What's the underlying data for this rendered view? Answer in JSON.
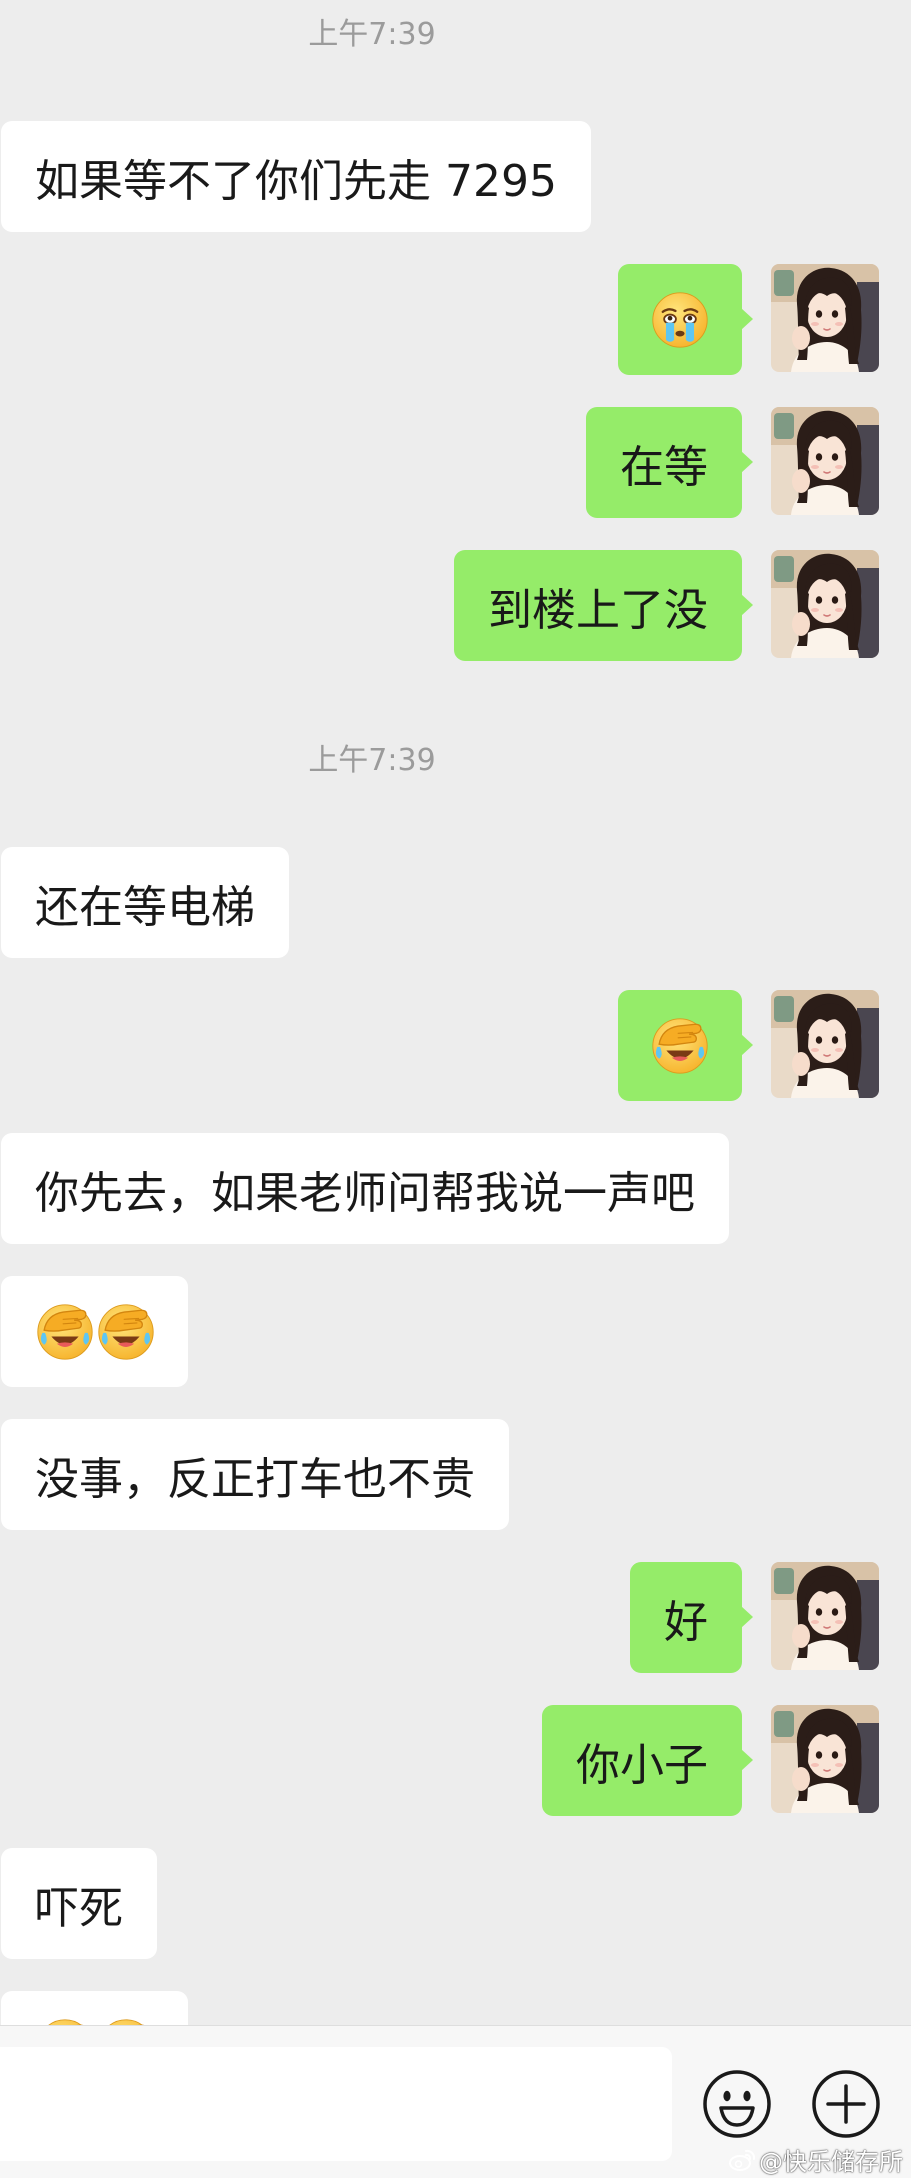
{
  "chat": [
    {
      "timestamp": "上午7:39"
    },
    {
      "incoming": {
        "text": "如果等不了你们先走 7295"
      }
    },
    {
      "outgoing": {
        "emojis": [
          "crying-face-icon"
        ]
      }
    },
    {
      "outgoing": {
        "text": "在等"
      }
    },
    {
      "outgoing": {
        "text": "到楼上了没"
      }
    },
    {
      "timestamp": "上午7:39"
    },
    {
      "incoming": {
        "text": "还在等电梯"
      }
    },
    {
      "outgoing": {
        "emojis": [
          "facepalm-face-icon"
        ]
      }
    },
    {
      "incoming": {
        "text": "你先去，如果老师问帮我说一声吧"
      }
    },
    {
      "incoming": {
        "emojis": [
          "facepalm-face-icon",
          "facepalm-face-icon"
        ]
      }
    },
    {
      "incoming": {
        "text": "没事，反正打车也不贵"
      }
    },
    {
      "outgoing": {
        "text": "好"
      }
    },
    {
      "outgoing": {
        "text": "你小子"
      }
    },
    {
      "incoming": {
        "text": "吓死"
      }
    },
    {
      "incoming": {
        "emojis": [
          "facepalm-face-icon",
          "facepalm-face-icon"
        ]
      }
    }
  ],
  "outgoing_avatar_icon": "user-avatar-photo-icon",
  "input_bar": {
    "value": "",
    "emoji_button_icon": "smiley-face-icon",
    "more_button_icon": "plus-circle-icon"
  },
  "watermark": {
    "logo_icon": "weibo-logo-icon",
    "text": "@快乐储存所"
  },
  "colors": {
    "chat_background": "#ededed",
    "incoming_bubble": "#ffffff",
    "outgoing_bubble": "#95ec69",
    "timestamp_text": "#9b9b9b",
    "message_text": "#191919",
    "input_bar_background": "#f7f7f7"
  }
}
